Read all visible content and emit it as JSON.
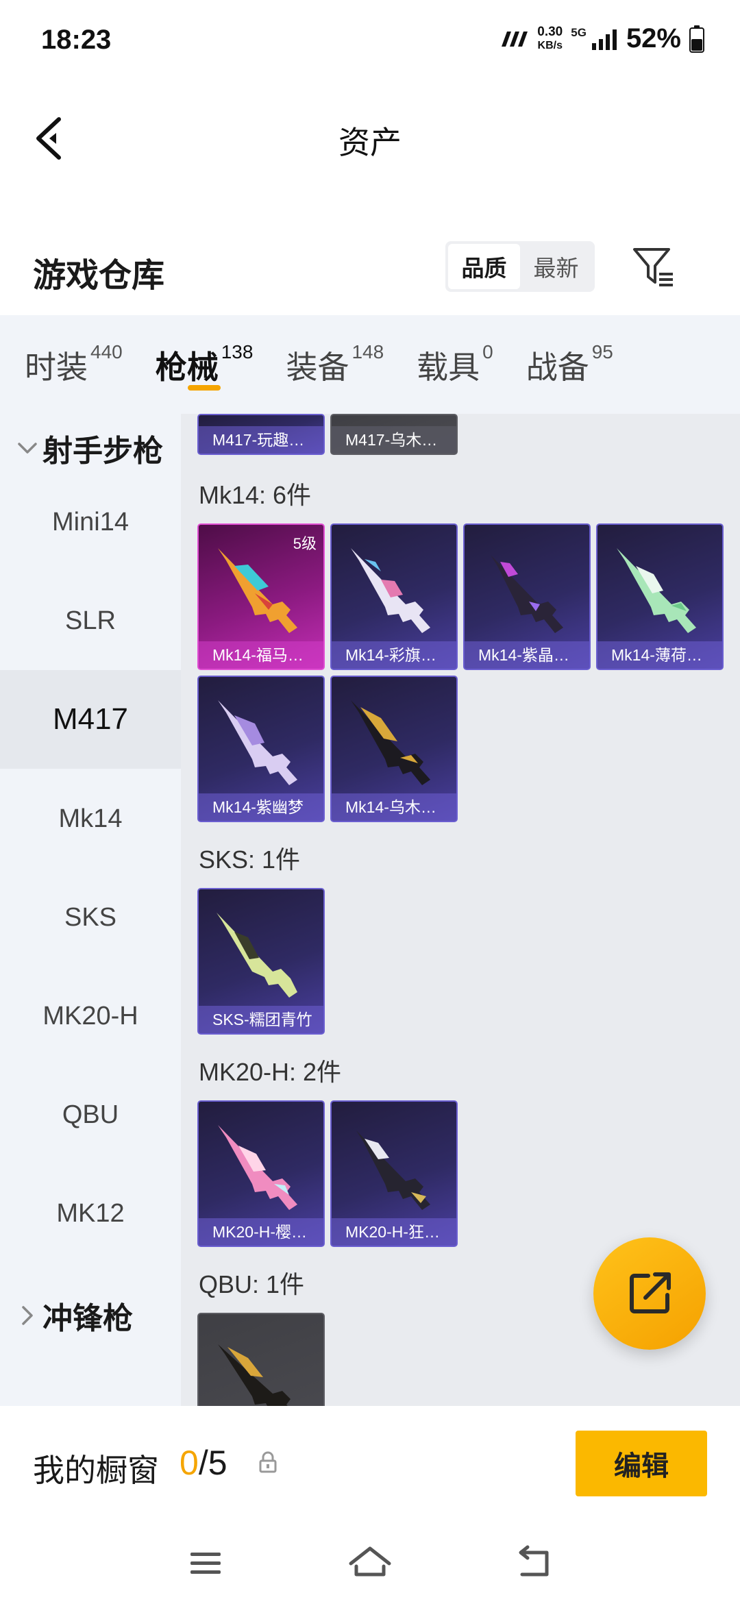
{
  "status_bar": {
    "time": "18:23",
    "net_speed_value": "0.30",
    "net_speed_unit": "KB/s",
    "network": "5G",
    "battery": "52%"
  },
  "header": {
    "title": "资产",
    "back_icon": "chevron-left-icon"
  },
  "warehouse": {
    "title": "游戏仓库",
    "sort_options": [
      "品质",
      "最新"
    ],
    "sort_selected": "品质",
    "filter_icon": "filter-icon"
  },
  "tabs": [
    {
      "label": "时装",
      "count": "440"
    },
    {
      "label": "枪械",
      "count": "138",
      "active": true
    },
    {
      "label": "装备",
      "count": "148"
    },
    {
      "label": "载具",
      "count": "0"
    },
    {
      "label": "战备",
      "count": "95"
    }
  ],
  "sidebar": {
    "group_open": "射手步枪",
    "items": [
      "Mini14",
      "SLR",
      "M417",
      "Mk14",
      "SKS",
      "MK20-H",
      "QBU",
      "MK12"
    ],
    "active_item": "M417",
    "group_closed": "冲锋枪"
  },
  "content": {
    "top_partial_cards": [
      "M417-玩趣…",
      "M417-乌木…"
    ],
    "sections": [
      {
        "title": "Mk14: 6件",
        "cards": [
          {
            "name": "Mk14-福马…",
            "level": "5级",
            "rarity": "pink"
          },
          {
            "name": "Mk14-彩旗…",
            "rarity": "purple"
          },
          {
            "name": "Mk14-紫晶…",
            "rarity": "purple"
          },
          {
            "name": "Mk14-薄荷…",
            "rarity": "purple"
          },
          {
            "name": "Mk14-紫幽梦",
            "rarity": "purple"
          },
          {
            "name": "Mk14-乌木…",
            "rarity": "purple"
          }
        ]
      },
      {
        "title": "SKS: 1件",
        "cards": [
          {
            "name": "SKS-糯团青竹",
            "rarity": "purple"
          }
        ]
      },
      {
        "title": "MK20-H: 2件",
        "cards": [
          {
            "name": "MK20-H-樱…",
            "rarity": "purple"
          },
          {
            "name": "MK20-H-狂…",
            "rarity": "purple"
          }
        ]
      },
      {
        "title": "QBU: 1件",
        "cards": []
      }
    ]
  },
  "fab": {
    "icon": "share-external-icon"
  },
  "showcase": {
    "label": "我的橱窗",
    "used": "0",
    "separator_total": "/5",
    "lock_icon": "lock-icon",
    "edit_label": "编辑"
  },
  "navbar": {
    "icons": [
      "menu-icon",
      "home-icon",
      "back-icon"
    ]
  },
  "colors": {
    "accent": "#f5a500",
    "card_purple": "#2f2a63",
    "card_pink": "#8b1a80"
  }
}
